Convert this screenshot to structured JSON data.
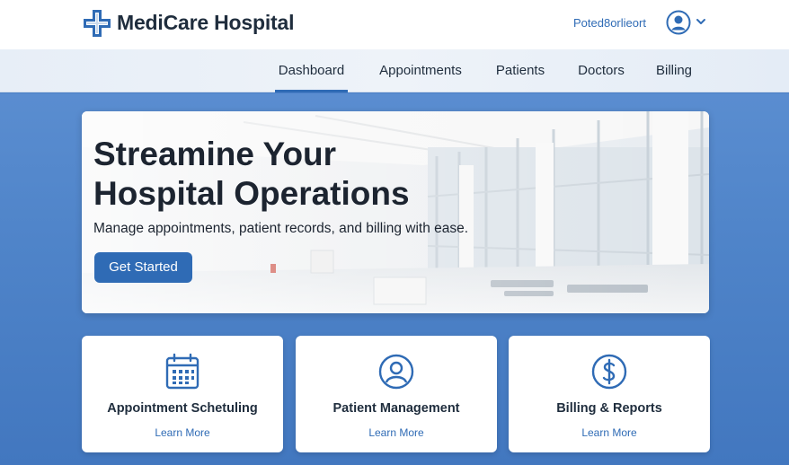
{
  "header": {
    "brand": "MediCare Hospital",
    "logo_icon": "medical-cross-icon",
    "user_name": "Poted8orlieort",
    "avatar_icon": "user-avatar-icon",
    "menu_icon": "chevron-down-icon"
  },
  "nav": {
    "items": [
      {
        "label": "Dashboard",
        "active": true
      },
      {
        "label": "Appointments",
        "active": false
      },
      {
        "label": "Patients",
        "active": false
      },
      {
        "label": "Doctors",
        "active": false
      },
      {
        "label": "Billing",
        "active": false
      }
    ]
  },
  "hero": {
    "title": "Streamine Your\nHospital Operations",
    "subtitle": "Manage appointments, patient records, and billing with ease.",
    "cta_label": "Get Started"
  },
  "cards": [
    {
      "title": "Appointment Schetuling",
      "link": "Learn More",
      "icon": "calendar-icon"
    },
    {
      "title": "Patient Management",
      "link": "Learn More",
      "icon": "user-icon"
    },
    {
      "title": "Billing & Reports",
      "link": "Learn More",
      "icon": "dollar-icon"
    }
  ],
  "colors": {
    "accent": "#2f6bb5",
    "background": "#4a7fc6",
    "text_dark": "#1f2d3d"
  }
}
